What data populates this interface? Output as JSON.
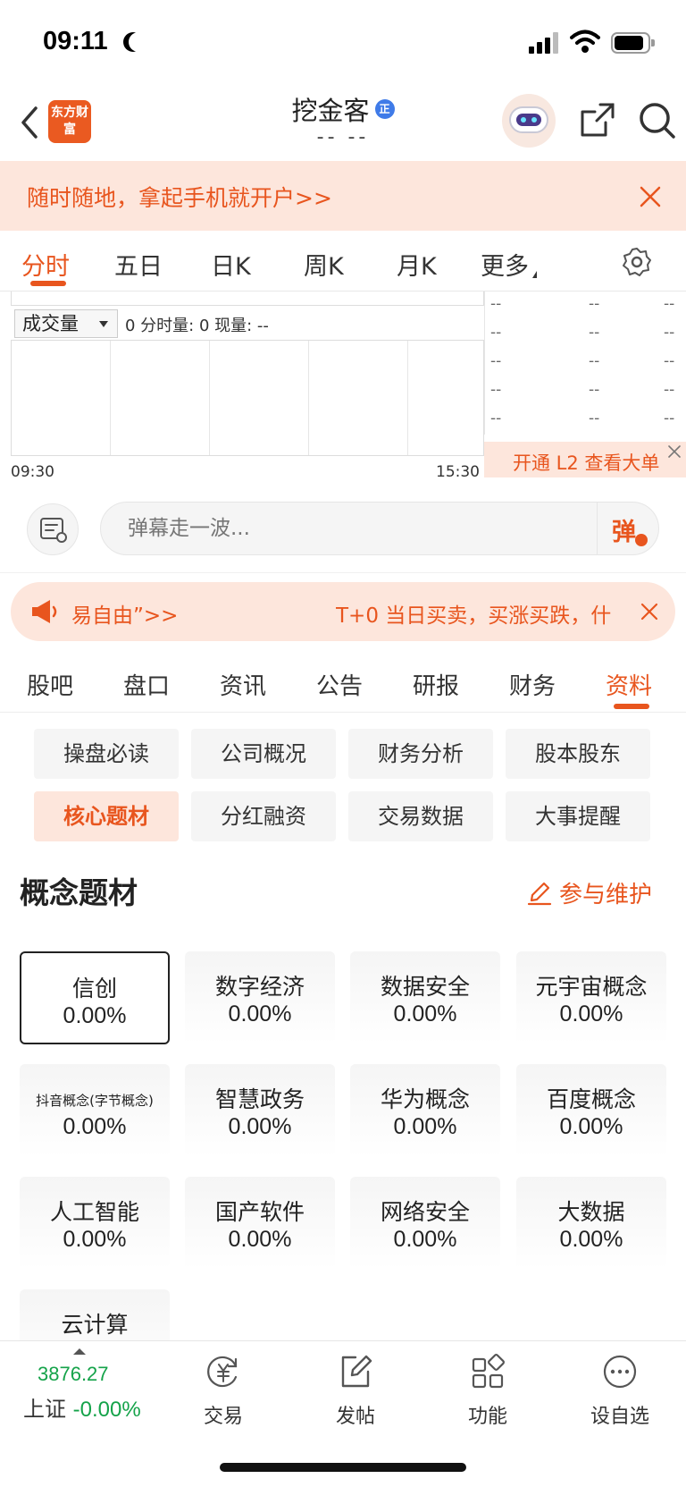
{
  "status_bar": {
    "time": "09:11"
  },
  "header": {
    "brand_logo": "东方财富",
    "title": "挖金客",
    "badge": "正",
    "subtitle": "-- --"
  },
  "promo_banner": {
    "text": "随时随地，拿起手机就开户>>"
  },
  "chart_tabs": [
    {
      "label": "分时",
      "active": true
    },
    {
      "label": "五日"
    },
    {
      "label": "日K"
    },
    {
      "label": "周K"
    },
    {
      "label": "月K"
    },
    {
      "label": "更多"
    }
  ],
  "chart": {
    "volume_select": "成交量",
    "volume_info": "0 分时量: 0 现量: --",
    "time_start": "09:30",
    "time_end": "15:30",
    "depth_rows": [
      [
        "--",
        "--",
        "--"
      ],
      [
        "--",
        "--",
        "--"
      ],
      [
        "--",
        "--",
        "--"
      ],
      [
        "--",
        "--",
        "--"
      ],
      [
        "--",
        "--",
        "--"
      ]
    ],
    "l2_text": "开通 L2 查看大单"
  },
  "danmu": {
    "placeholder": "弹幕走一波...",
    "send_label": "弹"
  },
  "notice": {
    "left_text": "易自由”>>",
    "right_text": "T+0 当日买卖，买涨买跌，什"
  },
  "section_tabs": [
    {
      "label": "股吧"
    },
    {
      "label": "盘口"
    },
    {
      "label": "资讯"
    },
    {
      "label": "公告"
    },
    {
      "label": "研报"
    },
    {
      "label": "财务"
    },
    {
      "label": "资料",
      "active": true
    }
  ],
  "subtabs": [
    {
      "label": "操盘必读"
    },
    {
      "label": "公司概况"
    },
    {
      "label": "财务分析"
    },
    {
      "label": "股本股东"
    },
    {
      "label": "核心题材",
      "active": true
    },
    {
      "label": "分红融资"
    },
    {
      "label": "交易数据"
    },
    {
      "label": "大事提醒"
    }
  ],
  "concepts": {
    "title": "概念题材",
    "maintain_label": "参与维护",
    "items": [
      {
        "name": "信创",
        "value": "0.00%",
        "selected": true
      },
      {
        "name": "数字经济",
        "value": "0.00%"
      },
      {
        "name": "数据安全",
        "value": "0.00%"
      },
      {
        "name": "元宇宙概念",
        "value": "0.00%"
      },
      {
        "name": "抖音概念(字节概念)",
        "value": "0.00%",
        "small": true
      },
      {
        "name": "智慧政务",
        "value": "0.00%"
      },
      {
        "name": "华为概念",
        "value": "0.00%"
      },
      {
        "name": "百度概念",
        "value": "0.00%"
      },
      {
        "name": "人工智能",
        "value": "0.00%"
      },
      {
        "name": "国产软件",
        "value": "0.00%"
      },
      {
        "name": "网络安全",
        "value": "0.00%"
      },
      {
        "name": "大数据",
        "value": "0.00%"
      },
      {
        "name": "云计算",
        "value": ""
      }
    ]
  },
  "bottom_nav": {
    "index_value": "3876.27",
    "index_name": "上证",
    "index_change": "-0.00%",
    "items": [
      {
        "label": "交易",
        "icon": "yuan-exchange-icon"
      },
      {
        "label": "发帖",
        "icon": "compose-icon"
      },
      {
        "label": "功能",
        "icon": "grid-icon"
      },
      {
        "label": "设自选",
        "icon": "more-dots-icon"
      }
    ]
  },
  "colors": {
    "accent": "#e8551e",
    "banner_bg": "#fde6dc",
    "index_green": "#15a34a"
  }
}
